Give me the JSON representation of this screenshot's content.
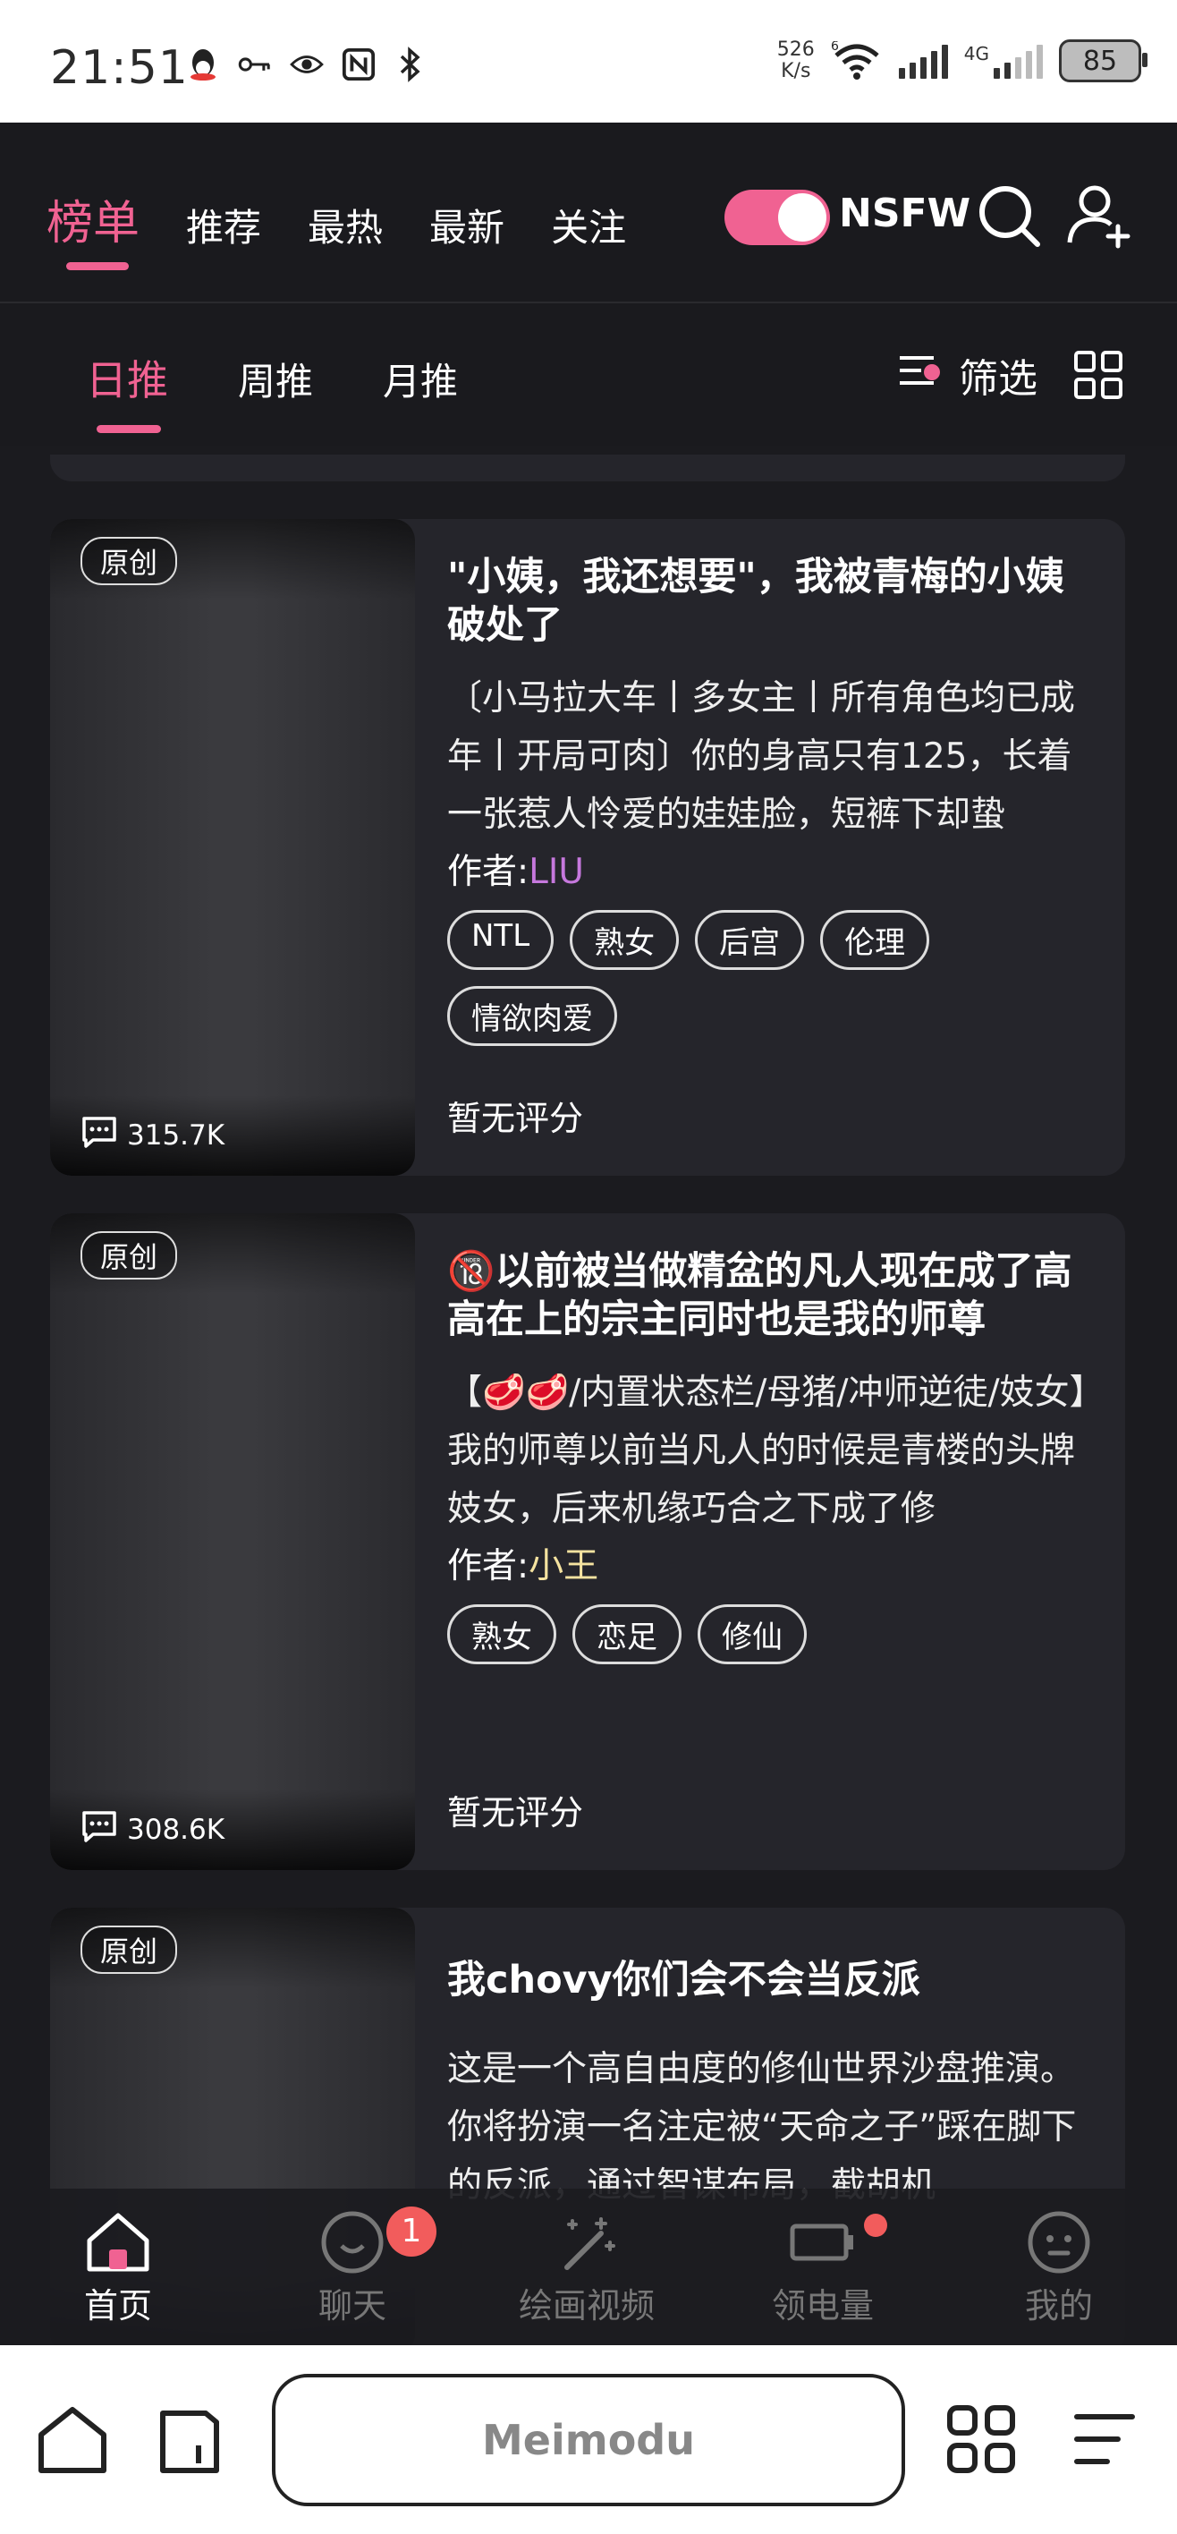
{
  "status_bar": {
    "time": "21:51",
    "speed_top": "526",
    "speed_bottom": "K/s",
    "battery": "85"
  },
  "header": {
    "tabs": [
      "榜单",
      "推荐",
      "最热",
      "最新",
      "关注"
    ],
    "nsfw_label": "NSFW",
    "accent_color": "#f06292"
  },
  "subheader": {
    "tabs": [
      "日推",
      "周推",
      "月推"
    ],
    "filter_label": "筛选"
  },
  "cards": [
    {
      "badge": "原创",
      "count": "315.7K",
      "title": "\"小姨，我还想要\"，我被青梅的小姨破处了",
      "description": "〔小马拉大车丨多女主丨所有角色均已成年丨开局可肉〕你的身高只有125，长着一张惹人怜爱的娃娃脸，短裤下却蛰",
      "author_label": "作者:",
      "author": "LIU",
      "author_color": "#c678dd",
      "tags": [
        "NTL",
        "熟女",
        "后宫",
        "伦理",
        "情欲肉爱"
      ],
      "rating": "暂无评分"
    },
    {
      "badge": "原创",
      "count": "308.6K",
      "title": "🔞以前被当做精盆的凡人现在成了高高在上的宗主同时也是我的师尊",
      "description": "【🥩🥩/内置状态栏/母猪/冲师逆徒/妓女】我的师尊以前当凡人的时候是青楼的头牌妓女，后来机缘巧合之下成了修",
      "author_label": "作者:",
      "author": "小王",
      "author_color": "#f5e3a0",
      "tags": [
        "熟女",
        "恋足",
        "修仙"
      ],
      "rating": "暂无评分"
    },
    {
      "badge": "原创",
      "count": "",
      "title": "我chovy你们会不会当反派",
      "description": "这是一个高自由度的修仙世界沙盘推演。你将扮演一名注定被“天命之子”踩在脚下的反派，通过智谋布局，截胡机",
      "author_label": "作者:",
      "author": "",
      "author_color": "#ffffff",
      "tags": [],
      "rating": ""
    }
  ],
  "bottom_nav": {
    "items": [
      "首页",
      "聊天",
      "绘画视频",
      "领电量",
      "我的"
    ],
    "chat_badge": "1"
  },
  "browser": {
    "url_text": "Meimodu"
  }
}
